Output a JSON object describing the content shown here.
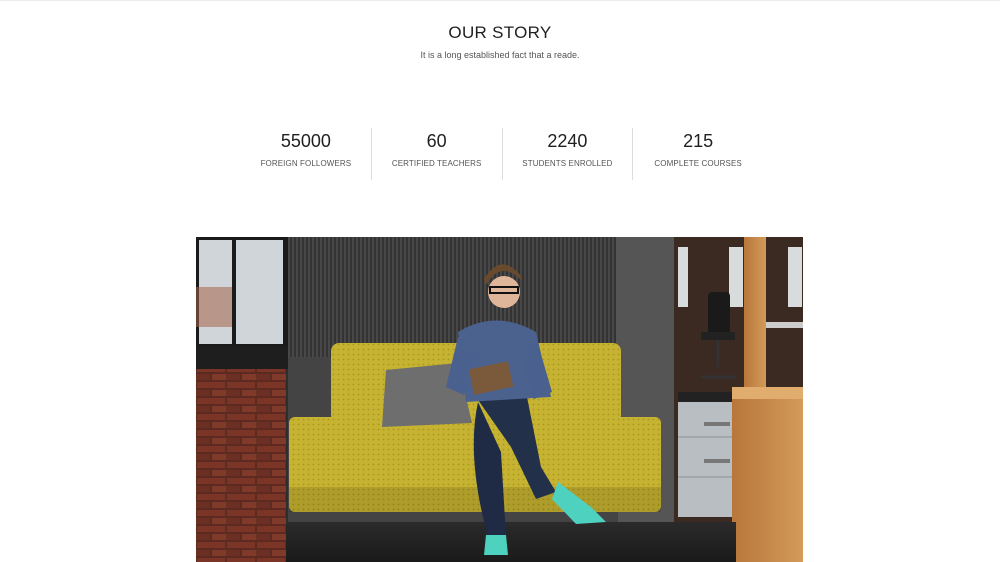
{
  "story": {
    "title": "OUR STORY",
    "subtitle": "It is a long established fact that a reade."
  },
  "stats": [
    {
      "number": "55000",
      "label": "FOREIGN FOLLOWERS"
    },
    {
      "number": "60",
      "label": "CERTIFIED TEACHERS"
    },
    {
      "number": "2240",
      "label": "STUDENTS ENROLLED"
    },
    {
      "number": "215",
      "label": "COMPLETE COURSES"
    }
  ],
  "colors": {
    "sofa": "#c9b634",
    "brick": "#6e2f22",
    "wall": "#4a4a4a",
    "shoe": "#4fd1c0"
  }
}
